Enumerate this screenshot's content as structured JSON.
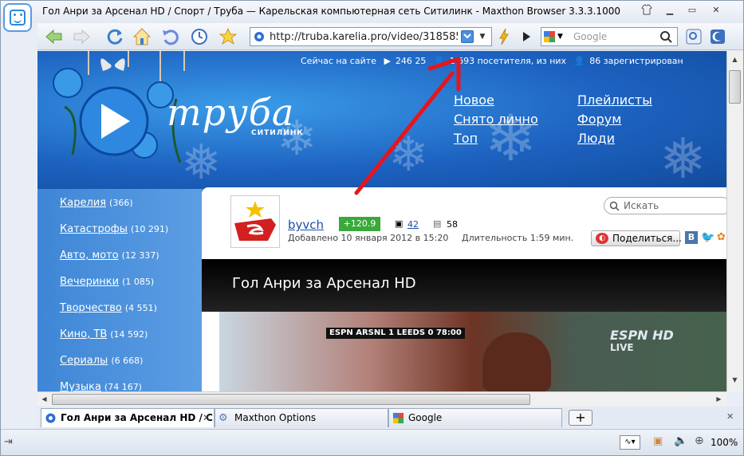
{
  "window": {
    "title": "Гол Анри за Арсенал HD / Спорт / Труба — Карельская компьютерная сеть Ситилинк - Maxthon Browser 3.3.3.1000"
  },
  "toolbar": {
    "url": "http://truba.karelia.pro/video/318585/",
    "search_placeholder": "Google",
    "icons": [
      "back-icon",
      "forward-icon",
      "refresh-icon",
      "home-icon",
      "undo-icon",
      "history-icon",
      "favorites-icon",
      "lightning-icon",
      "play-icon"
    ]
  },
  "site": {
    "status": {
      "online_label": "Сейчас на сайте",
      "videos": "246 25",
      "visitors": "1 693 посетителя, из них",
      "registered": "86 зарегистрирован"
    },
    "logo": {
      "text": "труба",
      "sub": "СИТИЛИНК"
    },
    "nav": [
      {
        "label": "Новое"
      },
      {
        "label": "Снято лично"
      },
      {
        "label": "Топ"
      },
      {
        "label": "Плейлисты"
      },
      {
        "label": "Форум"
      },
      {
        "label": "Люди"
      }
    ],
    "categories": [
      {
        "label": "Карелия",
        "count": "(366)"
      },
      {
        "label": "Катастрофы",
        "count": "(10 291)"
      },
      {
        "label": "Авто, мото",
        "count": "(12 337)"
      },
      {
        "label": "Вечеринки",
        "count": "(1 085)"
      },
      {
        "label": "Творчество",
        "count": "(4 551)"
      },
      {
        "label": "Кино, ТВ",
        "count": "(14 592)"
      },
      {
        "label": "Сериалы",
        "count": "(6 668)"
      },
      {
        "label": "Музыка",
        "count": "(74 167)"
      }
    ],
    "search_placeholder": "Искать",
    "video": {
      "author": "byvch",
      "rating": "+120.9",
      "comments": "42",
      "views": "58",
      "added": "Добавлено 10 января 2012 в 15:20",
      "duration": "Длительность 1:59 мин.",
      "share": "Поделиться...",
      "title": "Гол Анри за Арсенал HD",
      "scorebug": "ESPN  ARSNL 1  LEEDS 0  78:00",
      "overlay_brand": "ESPN HD",
      "overlay_live": "LIVE"
    }
  },
  "tabs": [
    {
      "label": "Гол Анри за Арсенал HD / С...",
      "active": true
    },
    {
      "label": "Maxthon Options",
      "active": false
    },
    {
      "label": "Google",
      "active": false
    }
  ],
  "newtab_label": "+",
  "statusbar": {
    "zoom": "100%"
  },
  "colors": {
    "accent": "#2f86d8",
    "annotation": "#e8141c",
    "rating_bg": "#3aa83a"
  }
}
